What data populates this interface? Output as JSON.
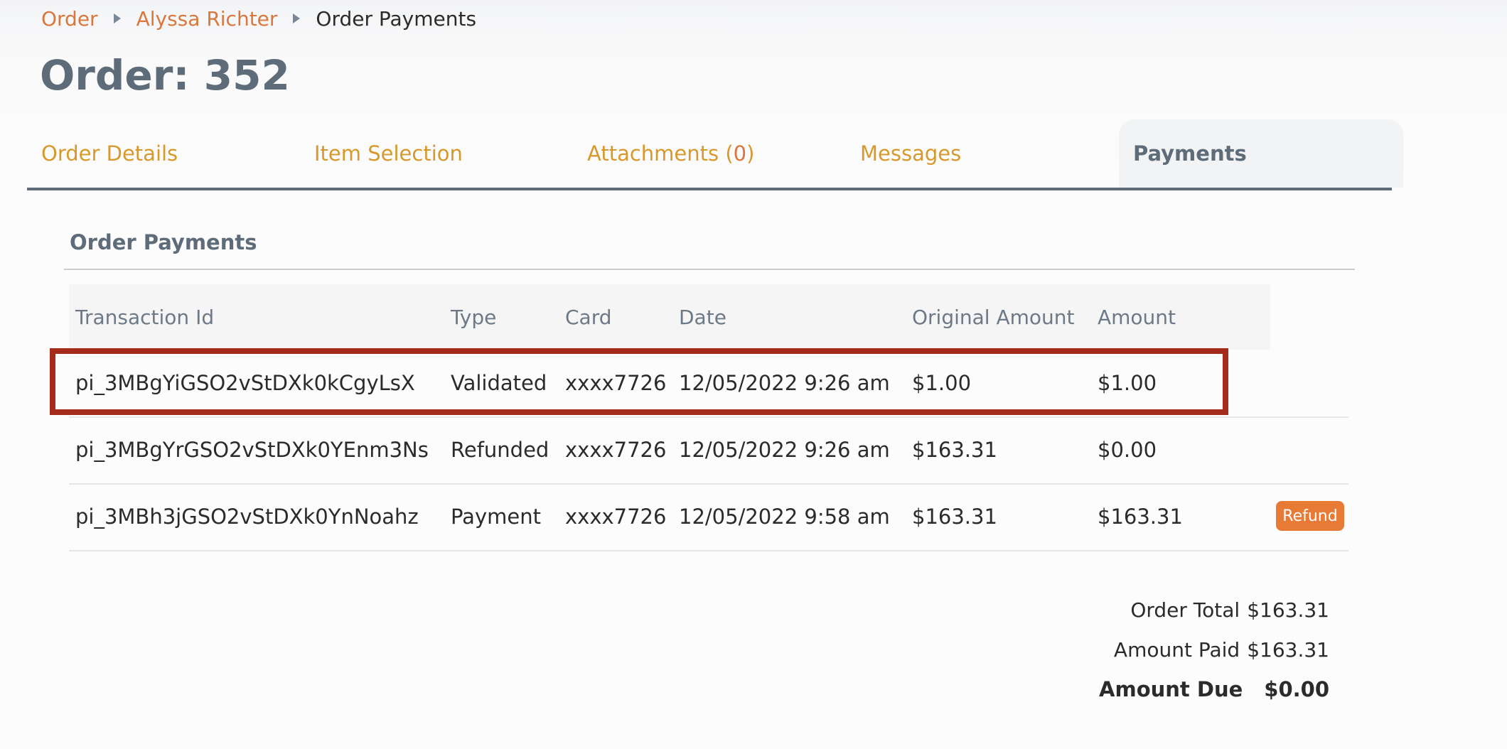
{
  "breadcrumb": {
    "items": [
      {
        "label": "Order"
      },
      {
        "label": "Alyssa Richter"
      },
      {
        "label": "Order Payments"
      }
    ]
  },
  "page_title": "Order: 352",
  "tabs": {
    "order_details": "Order Details",
    "item_selection": "Item Selection",
    "attachments_prefix": "Attachments (",
    "attachments_count": "0",
    "attachments_suffix": ")",
    "messages": "Messages",
    "payments": "Payments",
    "active": "Payments"
  },
  "section": {
    "title": "Order Payments"
  },
  "table": {
    "columns": [
      "Transaction Id",
      "Type",
      "Card",
      "Date",
      "Original Amount",
      "Amount"
    ],
    "rows": [
      {
        "id": "pi_3MBgYiGSO2vStDXk0kCgyLsX",
        "type": "Validated",
        "card": "xxxx7726",
        "date": "12/05/2022 9:26 am",
        "original": "$1.00",
        "amount": "$1.00"
      },
      {
        "id": "pi_3MBgYrGSO2vStDXk0YEnm3Ns",
        "type": "Refunded",
        "card": "xxxx7726",
        "date": "12/05/2022 9:26 am",
        "original": "$163.31",
        "amount": "$0.00"
      },
      {
        "id": "pi_3MBh3jGSO2vStDXk0YnNoahz",
        "type": "Payment",
        "card": "xxxx7726",
        "date": "12/05/2022 9:58 am",
        "original": "$163.31",
        "amount": "$163.31",
        "action": "Refund"
      }
    ]
  },
  "totals": {
    "order_total_label": "Order Total",
    "order_total_value": "$163.31",
    "amount_paid_label": "Amount Paid",
    "amount_paid_value": "$163.31",
    "amount_due_label": "Amount Due",
    "amount_due_value": "$0.00"
  },
  "colors": {
    "link": "#d9773c",
    "tab_link": "#d7992b",
    "heading": "#5e6b78",
    "highlight": "#a42a1b",
    "button": "#e77a34"
  }
}
